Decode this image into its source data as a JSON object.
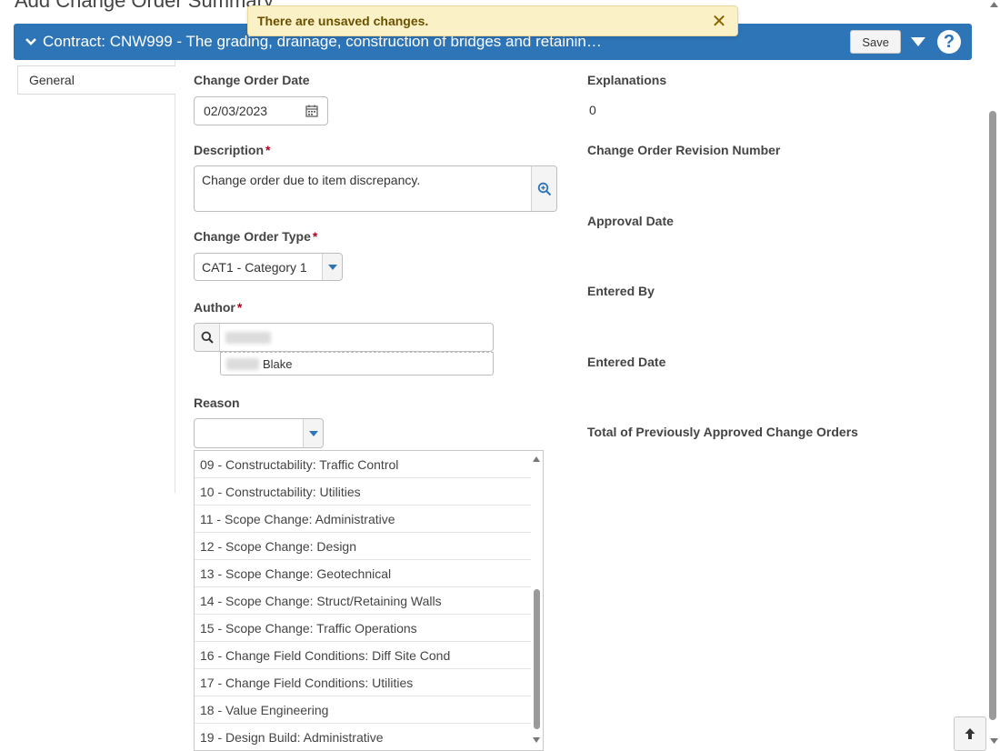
{
  "page": {
    "title": "Add Change Order Summary"
  },
  "notice": {
    "text": "There are unsaved changes.",
    "close_glyph": "✕"
  },
  "header": {
    "title": "Contract: CNW999 - The grading, drainage, construction of bridges and retainin…",
    "save_label": "Save",
    "help_glyph": "?"
  },
  "tabs": [
    {
      "label": "General"
    }
  ],
  "form": {
    "change_order_date": {
      "label": "Change Order Date",
      "value": "02/03/2023"
    },
    "description": {
      "label": "Description",
      "required": "*",
      "value": "Change order due to item discrepancy."
    },
    "change_order_type": {
      "label": "Change Order Type",
      "required": "*",
      "value": "CAT1 - Category 1"
    },
    "author": {
      "label": "Author",
      "required": "*",
      "suggestion_last_name": "Blake"
    },
    "reason": {
      "label": "Reason",
      "value": ""
    }
  },
  "summary": {
    "explanations": {
      "label": "Explanations",
      "value": "0"
    },
    "revision_number": {
      "label": "Change Order Revision Number"
    },
    "approval_date": {
      "label": "Approval Date"
    },
    "entered_by": {
      "label": "Entered By"
    },
    "entered_date": {
      "label": "Entered Date"
    },
    "total_previous": {
      "label": "Total of Previously Approved Change Orders"
    }
  },
  "reason_options": [
    "09 - Constructability: Traffic Control",
    "10 - Constructability: Utilities",
    "11 - Scope Change: Administrative",
    "12 - Scope Change: Design",
    "13 - Scope Change: Geotechnical",
    "14 - Scope Change: Struct/Retaining Walls",
    "15 - Scope Change: Traffic Operations",
    "16 - Change Field Conditions: Diff Site Cond",
    "17 - Change Field Conditions: Utilities",
    "18 - Value Engineering",
    "19 - Design Build: Administrative"
  ],
  "colors": {
    "header_blue": "#2e75b8",
    "notice_bg": "#fbf1c6",
    "required_red": "#b00020"
  }
}
